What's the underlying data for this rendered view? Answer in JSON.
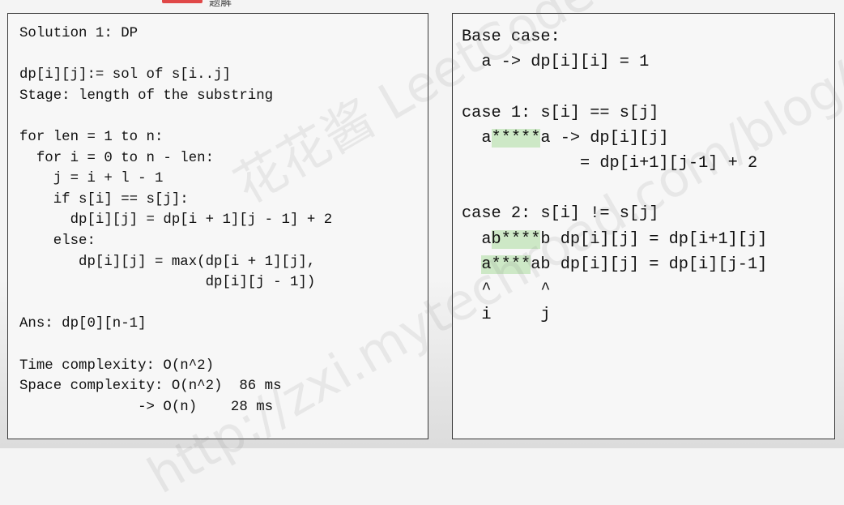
{
  "left": {
    "title": "Solution 1: DP",
    "def1": "dp[i][j]:= sol of s[i..j]",
    "def2": "Stage: length of the substring",
    "loop1": "for len = 1 to n:",
    "loop2": "  for i = 0 to n - len:",
    "loop3": "    j = i + l - 1",
    "loop4": "    if s[i] == s[j]:",
    "loop5": "      dp[i][j] = dp[i + 1][j - 1] + 2",
    "loop6": "    else:",
    "loop7": "       dp[i][j] = max(dp[i + 1][j],",
    "loop8": "                      dp[i][j - 1])",
    "ans": "Ans: dp[0][n-1]",
    "time": "Time complexity: O(n^2)",
    "space": "Space complexity: O(n^2)  86 ms",
    "space2": "              -> O(n)    28 ms"
  },
  "right": {
    "base_title": "Base case:",
    "base_line": "  a -> dp[i][i] = 1",
    "case1_title": "case 1: s[i] == s[j]",
    "case1_pre": "  a",
    "case1_hl": "*****",
    "case1_post": "a -> dp[i][j]",
    "case1_line2": "            = dp[i+1][j-1] + 2",
    "case2_title": "case 2: s[i] != s[j]",
    "case2a_pre": "  a",
    "case2a_hl": "b****",
    "case2a_post": "b dp[i][j] = dp[i+1][j]",
    "case2b_pre": "  ",
    "case2b_hl": "a****",
    "case2b_post": "ab dp[i][j] = dp[i][j-1]",
    "caret_line": "  ^     ^",
    "ij_line": "  i     j"
  },
  "watermark": "花花酱 LeetCode",
  "watermark_url": "http://zxi.mytechroad.com/blog/",
  "header_text": "题解"
}
